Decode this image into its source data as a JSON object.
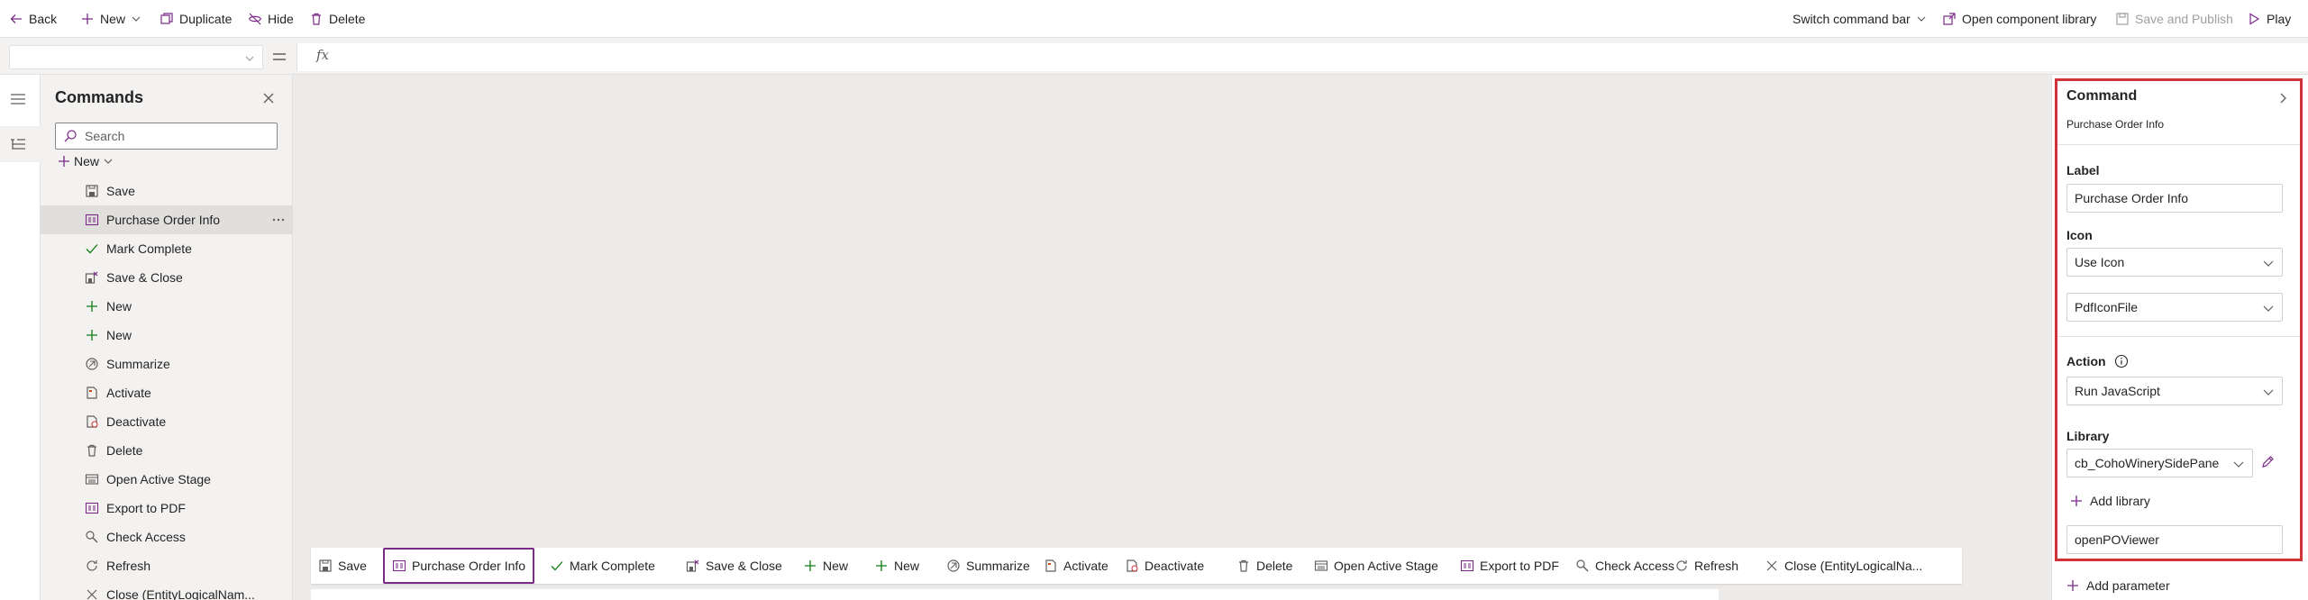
{
  "topbar": {
    "back": "Back",
    "new": "New",
    "duplicate": "Duplicate",
    "hide": "Hide",
    "delete": "Delete",
    "switch_command_bar": "Switch command bar",
    "open_component_library": "Open component library",
    "save_and_publish": "Save and Publish",
    "play": "Play"
  },
  "formula_bar": {
    "property_value": "",
    "fx_label": "fx",
    "formula": ""
  },
  "commands_panel": {
    "title": "Commands",
    "search_placeholder": "Search",
    "new_label": "New",
    "items": [
      {
        "label": "Save",
        "icon": "save-icon"
      },
      {
        "label": "Purchase Order Info",
        "icon": "pdf-file-icon",
        "selected": true
      },
      {
        "label": "Mark Complete",
        "icon": "checkmark-icon"
      },
      {
        "label": "Save & Close",
        "icon": "save-close-icon"
      },
      {
        "label": "New",
        "icon": "add-icon"
      },
      {
        "label": "New",
        "icon": "add-icon"
      },
      {
        "label": "Summarize",
        "icon": "summarize-icon"
      },
      {
        "label": "Activate",
        "icon": "activate-icon"
      },
      {
        "label": "Deactivate",
        "icon": "deactivate-icon"
      },
      {
        "label": "Delete",
        "icon": "delete-icon"
      },
      {
        "label": "Open Active Stage",
        "icon": "stage-icon"
      },
      {
        "label": "Export to PDF",
        "icon": "pdf-file-icon"
      },
      {
        "label": "Check Access",
        "icon": "check-access-icon"
      },
      {
        "label": "Refresh",
        "icon": "refresh-icon"
      },
      {
        "label": "Close (EntityLogicalNam...",
        "icon": "close-icon"
      }
    ]
  },
  "preview_bar": {
    "items": [
      {
        "label": "Save",
        "icon": "save-icon"
      },
      {
        "label": "Purchase Order Info",
        "icon": "pdf-file-icon",
        "selected": true
      },
      {
        "label": "Mark Complete",
        "icon": "checkmark-icon"
      },
      {
        "label": "Save & Close",
        "icon": "save-close-icon"
      },
      {
        "label": "New",
        "icon": "add-icon"
      },
      {
        "label": "New",
        "icon": "add-icon"
      },
      {
        "label": "Summarize",
        "icon": "summarize-icon"
      },
      {
        "label": "Activate",
        "icon": "activate-icon"
      },
      {
        "label": "Deactivate",
        "icon": "deactivate-icon"
      },
      {
        "label": "Delete",
        "icon": "delete-icon"
      },
      {
        "label": "Open Active Stage",
        "icon": "stage-icon"
      },
      {
        "label": "Export to PDF",
        "icon": "pdf-file-icon"
      },
      {
        "label": "Check Access",
        "icon": "check-access-icon"
      },
      {
        "label": "Refresh",
        "icon": "refresh-icon"
      },
      {
        "label": "Close (EntityLogicalNa...",
        "icon": "close-icon"
      }
    ]
  },
  "properties": {
    "title": "Command",
    "subtitle": "Purchase Order Info",
    "label_heading": "Label",
    "label_value": "Purchase Order Info",
    "icon_heading": "Icon",
    "icon_mode": "Use Icon",
    "icon_value": "PdfIconFile",
    "action_heading": "Action",
    "action_value": "Run JavaScript",
    "library_heading": "Library",
    "library_value": "cb_CohoWinerySidePane",
    "add_library": "Add library",
    "function_name": "openPOViewer",
    "add_parameter": "Add parameter"
  },
  "colors": {
    "accent": "#7a2a87",
    "highlight_box": "#d13438",
    "canvas": "#edebe9",
    "panel": "#f3f2f1"
  }
}
